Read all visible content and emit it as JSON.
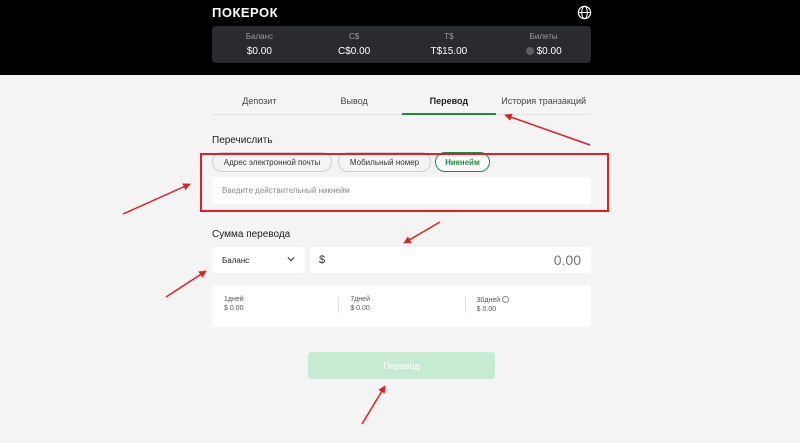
{
  "header": {
    "logo": "ПОКЕРОК",
    "wallet": [
      {
        "label": "Баланс",
        "value": "$0.00"
      },
      {
        "label": "C$",
        "value": "C$0.00"
      },
      {
        "label": "T$",
        "value": "T$15.00"
      },
      {
        "label": "Билеты",
        "value": "$0.00"
      }
    ]
  },
  "tabs": [
    {
      "label": "Депозит"
    },
    {
      "label": "Вывод"
    },
    {
      "label": "Перевод"
    },
    {
      "label": "История транзакций"
    }
  ],
  "transfer": {
    "title": "Перечислить",
    "methods": [
      "Адрес электронной почты",
      "Мобильный номер",
      "Никнейм"
    ],
    "selected_method": "Никнейм",
    "nickname_placeholder": "Введите действительный никнейм",
    "nickname_value": ""
  },
  "amount": {
    "title": "Сумма перевода",
    "source": "Баланс",
    "currency": "$",
    "placeholder": "0.00"
  },
  "limits": [
    {
      "label": "1дней",
      "value": "$ 0.00"
    },
    {
      "label": "7дней",
      "value": "$ 0.00"
    },
    {
      "label": "30дней",
      "value": "$ 0.00"
    }
  ],
  "submit_label": "Перевод",
  "colors": {
    "accent": "#1e8a3c",
    "annotation": "#e31e24",
    "header_bg": "#000000",
    "wallet_bg": "#2a2b2f"
  }
}
